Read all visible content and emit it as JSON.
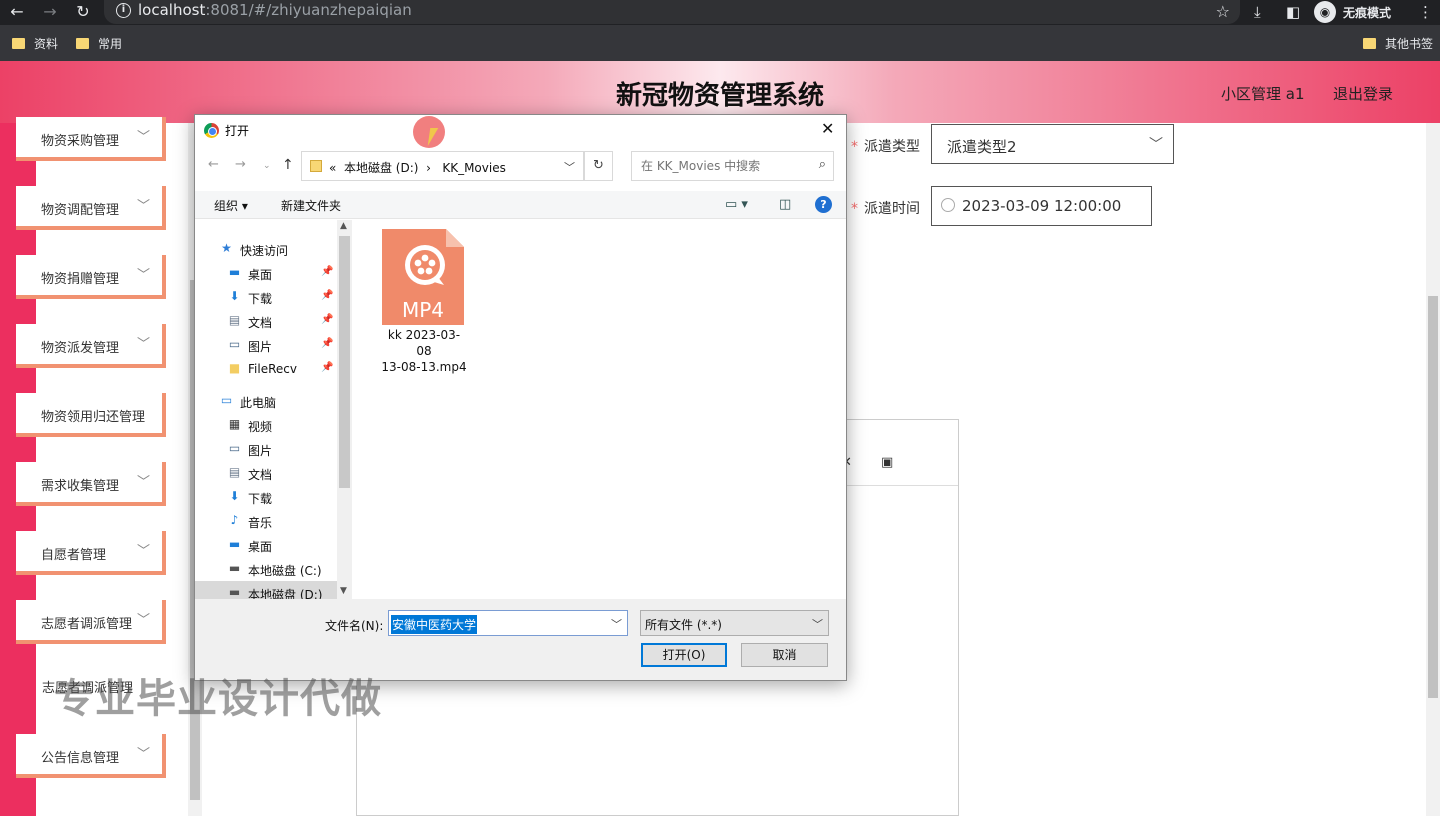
{
  "browser": {
    "url_host": "localhost",
    "url_rest": ":8081/#/zhiyuanzhepaiqian",
    "incognito_label": "无痕模式",
    "bookmarks": [
      "资料",
      "常用"
    ],
    "bookmark_other": "其他书签"
  },
  "app": {
    "title": "新冠物资管理系统",
    "user_label": "小区管理 a1",
    "logout_label": "退出登录"
  },
  "sidebar": {
    "items": [
      {
        "label": "物资采购管理",
        "has_chevron": true
      },
      {
        "label": "物资调配管理",
        "has_chevron": true
      },
      {
        "label": "物资捐赠管理",
        "has_chevron": true
      },
      {
        "label": "物资派发管理",
        "has_chevron": true
      },
      {
        "label": "物资领用归还管理",
        "has_chevron": false
      },
      {
        "label": "需求收集管理",
        "has_chevron": true
      },
      {
        "label": "自愿者管理",
        "has_chevron": true
      },
      {
        "label": "志愿者调派管理",
        "has_chevron": true
      },
      {
        "label": "公告信息管理",
        "has_chevron": true
      }
    ],
    "hidden_item_label": "志愿者调派管理"
  },
  "form": {
    "dispatch_type_label": "派遣类型",
    "dispatch_type_value": "派遣类型2",
    "dispatch_time_label": "派遣时间",
    "dispatch_time_value": "2023-03-09 12:00:00"
  },
  "watermark": "专业毕业设计代做",
  "dialog": {
    "title": "打开",
    "path_prefix": "«",
    "path_drive": "本地磁盘 (D:)",
    "path_folder": "KK_Movies",
    "search_placeholder": "在 KK_Movies 中搜索",
    "organize_label": "组织",
    "new_folder_label": "新建文件夹",
    "nav_items": [
      {
        "label": "快速访问",
        "icon": "star-icon",
        "pinned": false,
        "level": 0
      },
      {
        "label": "桌面",
        "icon": "desktop-icon",
        "pinned": true,
        "level": 1
      },
      {
        "label": "下载",
        "icon": "download-icon",
        "pinned": true,
        "level": 1
      },
      {
        "label": "文档",
        "icon": "document-icon",
        "pinned": true,
        "level": 1
      },
      {
        "label": "图片",
        "icon": "picture-icon",
        "pinned": true,
        "level": 1
      },
      {
        "label": "FileRecv",
        "icon": "folder-icon",
        "pinned": true,
        "level": 1
      },
      {
        "label": "此电脑",
        "icon": "computer-icon",
        "pinned": false,
        "level": 0
      },
      {
        "label": "视频",
        "icon": "video-icon",
        "pinned": false,
        "level": 1
      },
      {
        "label": "图片",
        "icon": "picture-icon",
        "pinned": false,
        "level": 1
      },
      {
        "label": "文档",
        "icon": "document-icon",
        "pinned": false,
        "level": 1
      },
      {
        "label": "下载",
        "icon": "download-icon",
        "pinned": false,
        "level": 1
      },
      {
        "label": "音乐",
        "icon": "music-icon",
        "pinned": false,
        "level": 1
      },
      {
        "label": "桌面",
        "icon": "desktop-icon",
        "pinned": false,
        "level": 1
      },
      {
        "label": "本地磁盘 (C:)",
        "icon": "drive-icon",
        "pinned": false,
        "level": 1
      },
      {
        "label": "本地磁盘 (D:)",
        "icon": "drive-icon",
        "pinned": false,
        "level": 1,
        "selected": true
      }
    ],
    "file": {
      "badge": "MP4",
      "name_line1": "kk 2023-03-08",
      "name_line2": "13-08-13.mp4"
    },
    "filename_label": "文件名(N):",
    "filename_value": "安徽中医药大学",
    "filter_value": "所有文件 (*.*)",
    "open_label": "打开(O)",
    "cancel_label": "取消"
  },
  "colors": {
    "sidebar_strip": "#ec2f5f",
    "sidebar_border": "#f19271",
    "required_star": "#f56c6c",
    "mp4_orange": "#f08a6a",
    "selection_blue": "#0078d7"
  }
}
